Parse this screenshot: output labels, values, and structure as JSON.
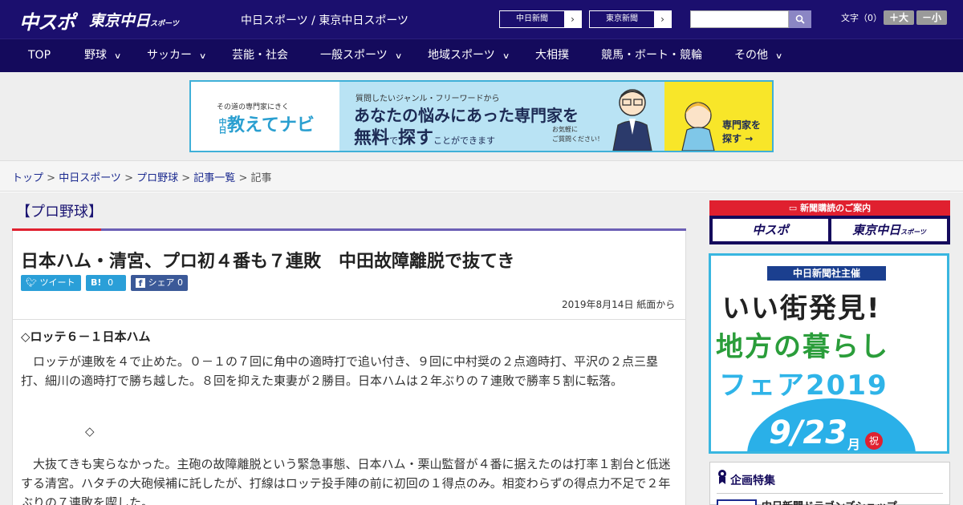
{
  "header": {
    "logo_main": "中スポ",
    "logo_tokyo": "東京中日",
    "logo_tokyo_small": "スポーツ",
    "site_name": "中日スポーツ / 東京中日スポーツ",
    "paper_links": [
      {
        "label": "中日新聞"
      },
      {
        "label": "東京新聞"
      }
    ],
    "search": {
      "value": "",
      "placeholder": ""
    },
    "font_size_label": "文字（0）",
    "font_bigger": "＋大",
    "font_smaller": "－小"
  },
  "nav": {
    "items": [
      {
        "label": "TOP",
        "has_menu": false
      },
      {
        "label": "野球",
        "has_menu": true
      },
      {
        "label": "サッカー",
        "has_menu": true
      },
      {
        "label": "芸能・社会",
        "has_menu": false
      },
      {
        "label": "一般スポーツ",
        "has_menu": true
      },
      {
        "label": "地域スポーツ",
        "has_menu": true
      },
      {
        "label": "大相撲",
        "has_menu": false
      },
      {
        "label": "競馬・ボート・競輪",
        "has_menu": false
      },
      {
        "label": "その他",
        "has_menu": true
      }
    ]
  },
  "ad_banner": {
    "left_small": "その道の専門家にきく",
    "left_prefix": "中日",
    "left_brand": "教えてナビ",
    "line1": "質問したいジャンル・フリーワードから",
    "line2": "あなたの悩みにあった専門家を",
    "line3_strong": "無料",
    "line3_mid": "で",
    "line3_strong2": "探す",
    "line3_tail": "ことができます",
    "note_1": "お気軽に",
    "note_2": "ご質問ください！",
    "cta_1": "専門家を",
    "cta_2": "探す"
  },
  "breadcrumb": [
    {
      "label": "トップ",
      "link": true
    },
    {
      "label": "中日スポーツ",
      "link": true
    },
    {
      "label": "プロ野球",
      "link": true
    },
    {
      "label": "記事一覧",
      "link": true
    },
    {
      "label": "記事",
      "link": false
    }
  ],
  "article": {
    "category": "【プロ野球】",
    "title": "日本ハム・清宮、プロ初４番も７連敗　中田故障離脱で抜てき",
    "share": {
      "tweet": "ツイート",
      "hatena": "B!",
      "hatena_count": "0",
      "facebook": "シェア",
      "facebook_count": "0"
    },
    "date": "2019年8月14日 紙面から",
    "subhead": "◇ロッテ６－１日本ハム",
    "para1": "　ロッテが連敗を４で止めた。０－１の７回に角中の適時打で追い付き、９回に中村奨の２点適時打、平沢の２点三塁打、細川の適時打で勝ち越した。８回を抑えた東妻が２勝目。日本ハムは２年ぶりの７連敗で勝率５割に転落。",
    "separator": "◇",
    "para2": "　大抜てきも実らなかった。主砲の故障離脱という緊急事態、日本ハム・栗山監督が４番に据えたのは打率１割台と低迷する清宮。ハタチの大砲候補に託したが、打線はロッテ投手陣の前に初回の１得点のみ。相変わらずの得点力不足で２年ぶりの７連敗を喫した。"
  },
  "sidebar": {
    "subscribe_head": "新聞購読のご案内",
    "subscribe_a": "中スポ",
    "subscribe_b": "東京中日",
    "subscribe_b_small": "スポーツ",
    "fair": {
      "tag": "中日新聞社主催",
      "row1": "いい街発見!",
      "row2": "地方の暮らし",
      "row3": "フェア2019",
      "date": "9/23",
      "month_suffix": "月",
      "holiday": "祝"
    },
    "special_head": "企画特集",
    "special_item": "中日新聞ドラゴンズショップ"
  },
  "colors": {
    "header_bg": "#1b0f6e",
    "nav_bg": "#140a5c",
    "accent_red": "#e0202f",
    "accent_purple": "#6c5fb5",
    "link": "#1b2a8f",
    "twitter": "#2a9fd8",
    "hatena": "#2a9fd8",
    "facebook": "#3b5998"
  }
}
